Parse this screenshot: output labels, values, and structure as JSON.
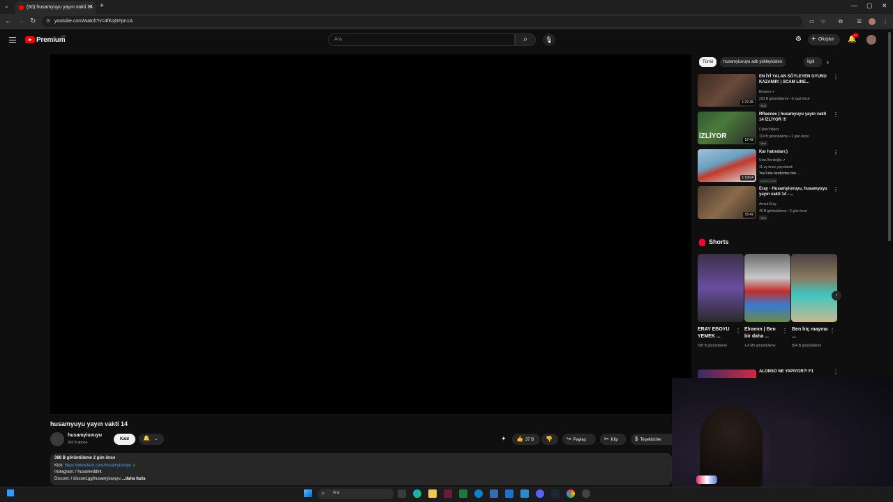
{
  "browser": {
    "tab_title": "(60) husamyuyu yayın vakti 14",
    "url": "youtube.com/watch?v=4fKqGFpn1A"
  },
  "header": {
    "logo_text": "Premium",
    "country_code": "CA",
    "search_placeholder": "Ara",
    "create_label": "Oluştur",
    "notification_count": "9+"
  },
  "video": {
    "title": "husamyuyu yayın vakti 14",
    "channel_name": "husamyiuvuyu",
    "subscribers": "320 B abone",
    "join_label": "Katıl",
    "likes": "37 B",
    "share_label": "Paylaş",
    "clip_label": "Klip",
    "thanks_label": "Teşekkürler"
  },
  "description": {
    "stats": "388 B görüntüleme  2 gün önce",
    "kick_label": "Kick:",
    "kick_link": "https://www.kick.com/husamyiuvuyu",
    "instagram": "Instagram:  / husameddint",
    "discord": "Discord:  / discord.gg/husamyiuvuyu",
    "more": "...daha fazla"
  },
  "chips": [
    {
      "label": "Tümü",
      "active": true
    },
    {
      "label": "husamyiuvuyu adlı yükleyiciden",
      "active": false
    },
    {
      "label": "İlgili",
      "active": false
    }
  ],
  "recommendations": [
    {
      "title": "EN İYİ YALAN SÖYLEYEN OYUNU KAZANIR! | SCAM LINE...",
      "channel": "Elraenn",
      "meta": "203 B görüntüleme • 6 saat önce",
      "badge": "Yeni",
      "duration": "1:27:35"
    },
    {
      "title": "RRaenee | husamyuyu yayın vakti 14 İZLİYOR !!!",
      "channel": "CyberVideos",
      "meta": "114 B görüntüleme • 2 gün önce",
      "badge": "Yeni",
      "duration": "17:42"
    },
    {
      "title": "Kar hatıraları:)",
      "channel": "Uras Benlioğlu",
      "meta": "11 ay önce yayınlandı",
      "meta2": "YouTube tarafından öne ...",
      "badge": "Üyelere özel",
      "duration": "1:19:04"
    },
    {
      "title": "Eray - Husamyiuvuyu, husamyuyu yayın vakti 14 - ...",
      "channel": "Armut Eray",
      "meta": "49 B görüntüleme • 2 gün önce",
      "badge": "Yeni",
      "duration": "15:42"
    }
  ],
  "shorts": {
    "heading": "Shorts",
    "items": [
      {
        "title": "ERAY EBOYU YEMEK ...",
        "views": "590 B görüntüleme"
      },
      {
        "title": "Elraenn | Ben bir daha ...",
        "views": "1,4 Mn görüntüleme"
      },
      {
        "title": "Ben hiç mayına ...",
        "views": "834 B görüntüleme"
      }
    ]
  },
  "next_rec": {
    "title": "ALONSO NE YAPIYOR?! F1"
  },
  "taskbar": {
    "search_label": "Ara"
  }
}
